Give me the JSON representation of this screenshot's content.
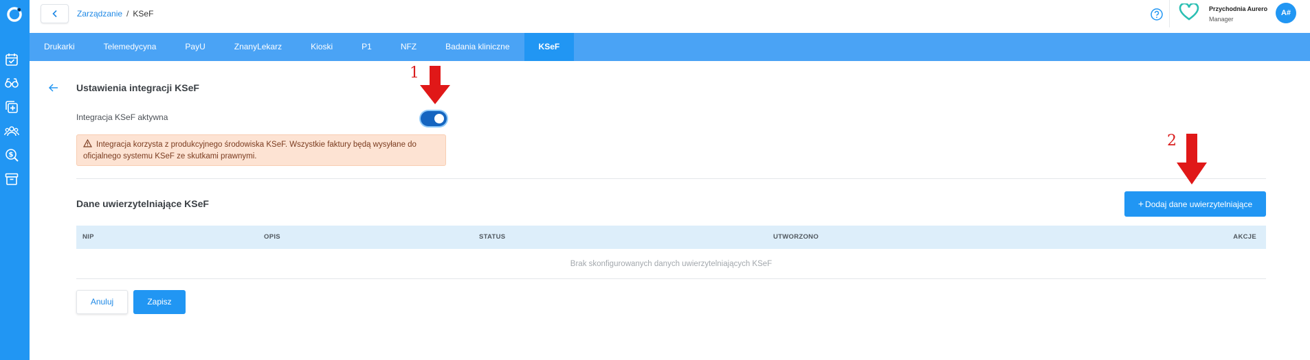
{
  "colors": {
    "primary": "#2196f3",
    "tabs_bg": "#4aa3f5",
    "warning_bg": "#fde3d3",
    "annotation": "#e01818"
  },
  "breadcrumb": {
    "parent": "Zarządzanie",
    "separator": "/",
    "current": "KSeF"
  },
  "account": {
    "org_name": "Przychodnia Aurero",
    "role": "Manager",
    "avatar_initials": "A#"
  },
  "sidebar_icons": [
    "calendar-check-icon",
    "glasses-icon",
    "medical-plus-icon",
    "users-icon",
    "search-dollar-icon",
    "archive-icon"
  ],
  "tabs": [
    {
      "label": "Drukarki",
      "active": false
    },
    {
      "label": "Telemedycyna",
      "active": false
    },
    {
      "label": "PayU",
      "active": false
    },
    {
      "label": "ZnanyLekarz",
      "active": false
    },
    {
      "label": "Kioski",
      "active": false
    },
    {
      "label": "P1",
      "active": false
    },
    {
      "label": "NFZ",
      "active": false
    },
    {
      "label": "Badania kliniczne",
      "active": false
    },
    {
      "label": "KSeF",
      "active": true
    }
  ],
  "settings": {
    "title": "Ustawienia integracji KSeF",
    "toggle_label": "Integracja KSeF aktywna",
    "toggle_on": true,
    "warning_text": "Integracja korzysta z produkcyjnego środowiska KSeF. Wszystkie faktury będą wysyłane do oficjalnego systemu KSeF ze skutkami prawnymi."
  },
  "credentials": {
    "title": "Dane uwierzytelniające KSeF",
    "add_button": "Dodaj dane uwierzytelniające",
    "columns": [
      "NIP",
      "OPIS",
      "STATUS",
      "UTWORZONO",
      "AKCJE"
    ],
    "empty_text": "Brak skonfigurowanych danych uwierzytelniających KSeF"
  },
  "actions": {
    "cancel": "Anuluj",
    "save": "Zapisz"
  },
  "annotations": [
    "1",
    "2"
  ]
}
